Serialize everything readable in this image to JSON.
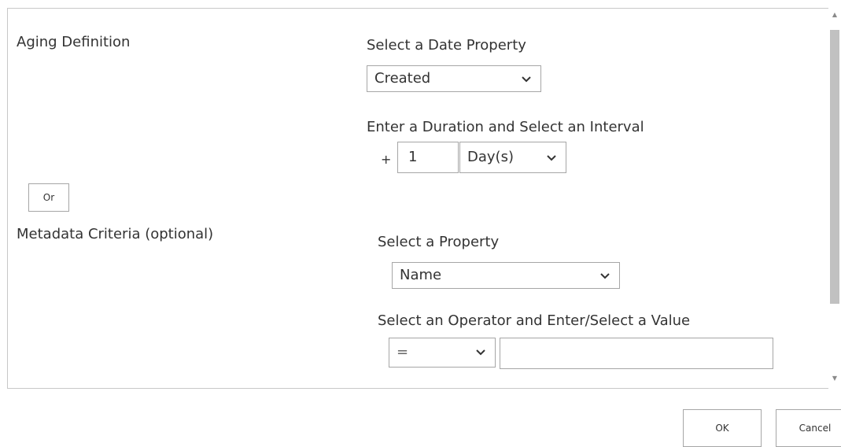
{
  "aging": {
    "heading": "Aging Definition",
    "date_property_label": "Select a Date Property",
    "date_property_value": "Created",
    "duration_label": "Enter a Duration and Select an Interval",
    "plus_sign": "+",
    "duration_value": "1",
    "interval_value": "Day(s)"
  },
  "or_button_label": "Or",
  "metadata": {
    "heading": "Metadata Criteria (optional)",
    "property_label": "Select a Property",
    "property_value": "Name",
    "operator_label": "Select an Operator and Enter/Select a Value",
    "operator_value": "=",
    "value_input": ""
  },
  "footer": {
    "ok_label": "OK",
    "cancel_label": "Cancel"
  },
  "icons": {
    "dropdown": "chevron-down-icon",
    "scroll_up": "scroll-up-arrow-icon",
    "scroll_down": "scroll-down-arrow-icon"
  }
}
